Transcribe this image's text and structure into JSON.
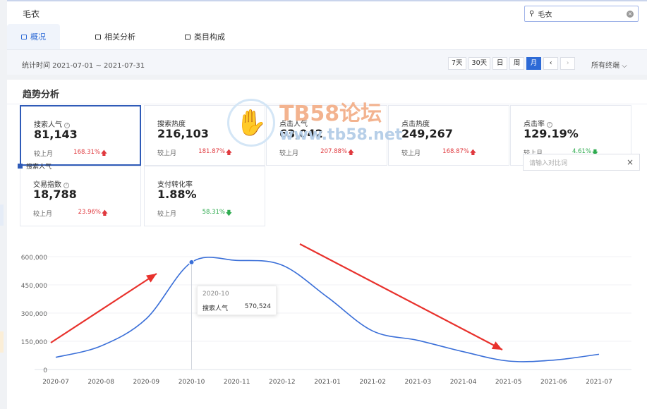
{
  "header": {
    "title": "毛衣",
    "search": {
      "value": "毛衣",
      "placeholder": ""
    },
    "tabs": [
      {
        "label": "概况",
        "active": true
      },
      {
        "label": "相关分析",
        "active": false
      },
      {
        "label": "类目构成",
        "active": false
      }
    ]
  },
  "toolbar": {
    "period": "统计时间 2021-07-01 ~ 2021-07-31",
    "ranges": [
      "7天",
      "30天",
      "日",
      "周",
      "月"
    ],
    "active_range": "月",
    "prev": "‹",
    "next": "›",
    "terminal": "所有终端"
  },
  "trend": {
    "title": "趋势分析",
    "compare_placeholder": "请输入对比词",
    "cards": [
      {
        "label": "搜索人气",
        "value": "81,143",
        "compare": "较上月",
        "change": "168.31%",
        "direction": "up",
        "info": true
      },
      {
        "label": "搜索热度",
        "value": "216,103",
        "compare": "较上月",
        "change": "181.87%",
        "direction": "up",
        "info": false
      },
      {
        "label": "点击人气",
        "value": "63,042",
        "compare": "较上月",
        "change": "207.88%",
        "direction": "up",
        "info": false
      },
      {
        "label": "点击热度",
        "value": "249,267",
        "compare": "较上月",
        "change": "168.87%",
        "direction": "up",
        "info": false
      },
      {
        "label": "点击率",
        "value": "129.19%",
        "compare": "较上月",
        "change": "4.61%",
        "direction": "down",
        "info": true
      },
      {
        "label": "交易指数",
        "value": "18,788",
        "compare": "较上月",
        "change": "23.96%",
        "direction": "up",
        "info": true
      },
      {
        "label": "支付转化率",
        "value": "1.88%",
        "compare": "较上月",
        "change": "58.31%",
        "direction": "down",
        "info": false
      }
    ]
  },
  "watermark": {
    "brand": "TB58论坛",
    "url": "www.tb58.net"
  },
  "tooltip": {
    "date": "2020-10",
    "name": "搜索人气",
    "value": "570,524"
  },
  "colors": {
    "accent": "#2d6ad6",
    "line": "#3a6fd8",
    "up": "#e0393e",
    "down": "#2eab4f",
    "arrow": "#e8312c"
  },
  "chart_data": {
    "type": "line",
    "x": [
      "2020-07",
      "2020-08",
      "2020-09",
      "2020-10",
      "2020-11",
      "2020-12",
      "2021-01",
      "2021-02",
      "2021-03",
      "2021-04",
      "2021-05",
      "2021-06",
      "2021-07"
    ],
    "series": [
      {
        "name": "搜索人气",
        "values": [
          65000,
          125000,
          270000,
          570524,
          580000,
          555000,
          385000,
          205000,
          155000,
          95000,
          45000,
          50000,
          81143
        ]
      }
    ],
    "yticks": [
      "0",
      "150,000",
      "300,000",
      "450,000",
      "600,000"
    ],
    "ylim": [
      0,
      600000
    ],
    "highlight_index": 3,
    "grid": true,
    "legend": "top-left"
  }
}
